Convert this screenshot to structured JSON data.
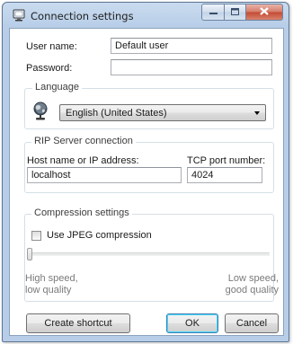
{
  "window": {
    "title": "Connection settings",
    "icon": "monitor-icon",
    "caption_buttons": [
      "minimize-icon",
      "maximize-icon",
      "close-icon"
    ]
  },
  "user": {
    "username_label": "User name:",
    "username_value": "Default user",
    "password_label": "Password:",
    "password_value": ""
  },
  "language": {
    "group_title": "Language",
    "icon": "globe-icon",
    "selected": "English (United States)"
  },
  "rip_server": {
    "group_title": "RIP Server connection",
    "host_label": "Host name or IP address:",
    "host_value": "localhost",
    "port_label": "TCP port number:",
    "port_value": "4024"
  },
  "compression": {
    "group_title": "Compression settings",
    "jpeg_label": "Use JPEG compression",
    "jpeg_checked": false,
    "slider_level": 0,
    "low_end_label": "High speed,\nlow quality",
    "high_end_label": "Low speed,\ngood quality"
  },
  "buttons": {
    "create_shortcut": "Create shortcut",
    "ok": "OK",
    "cancel": "Cancel"
  }
}
